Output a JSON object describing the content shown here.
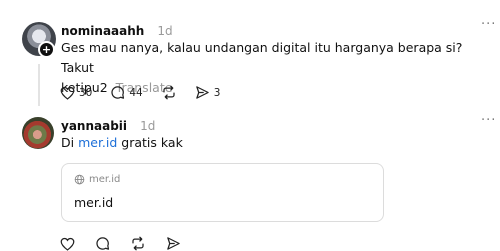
{
  "post1": {
    "username": "nominaaahh",
    "time": "1d",
    "text_line1": "Ges mau nanya, kalau undangan digital itu harganya berapa si? Takut",
    "text_line2": "ketipu2",
    "translate": "Translate",
    "likes": "30",
    "comments": "44",
    "shares": "3",
    "more": "···"
  },
  "post2": {
    "username": "yannaabii",
    "time": "1d",
    "text_prefix": "Di ",
    "link_text": "mer.id",
    "text_suffix": " gratis kak",
    "more": "···",
    "card": {
      "domain": "mer.id",
      "title": "mer.id"
    }
  },
  "icons": {
    "like": "heart-icon",
    "comment": "comment-icon",
    "repost": "repost-icon",
    "share": "send-icon",
    "globe": "globe-icon",
    "follow": "plus-icon"
  }
}
